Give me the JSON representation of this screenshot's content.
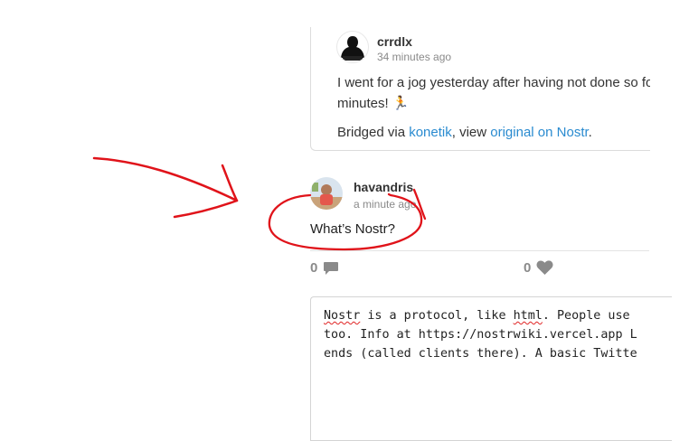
{
  "quoted_note": {
    "author": "crrdlx",
    "time": "34 minutes ago",
    "body_line1": "I went for a jog yesterday after having not done so for",
    "body_line2": "minutes! 🏃",
    "bridge_prefix": "Bridged via ",
    "bridge_link": "konetik",
    "bridge_mid": ", view ",
    "original_link": "original on Nostr",
    "bridge_suffix": "."
  },
  "post": {
    "author": "havandris",
    "time": "a minute ago",
    "body": "What’s Nostr?"
  },
  "stats": {
    "replies": "0",
    "likes": "0"
  },
  "reply_editor": {
    "line1_w1": "Nostr",
    "line1_mid": " is a protocol, like ",
    "line1_w2": "html",
    "line1_end": ". People use ",
    "line2": "too. Info at https://nostrwiki.vercel.app L",
    "line3": "ends (called clients there). A basic Twitte"
  },
  "colors": {
    "link": "#2a8bd0",
    "annotation": "#e0131a",
    "muted": "#8a8a8a"
  }
}
